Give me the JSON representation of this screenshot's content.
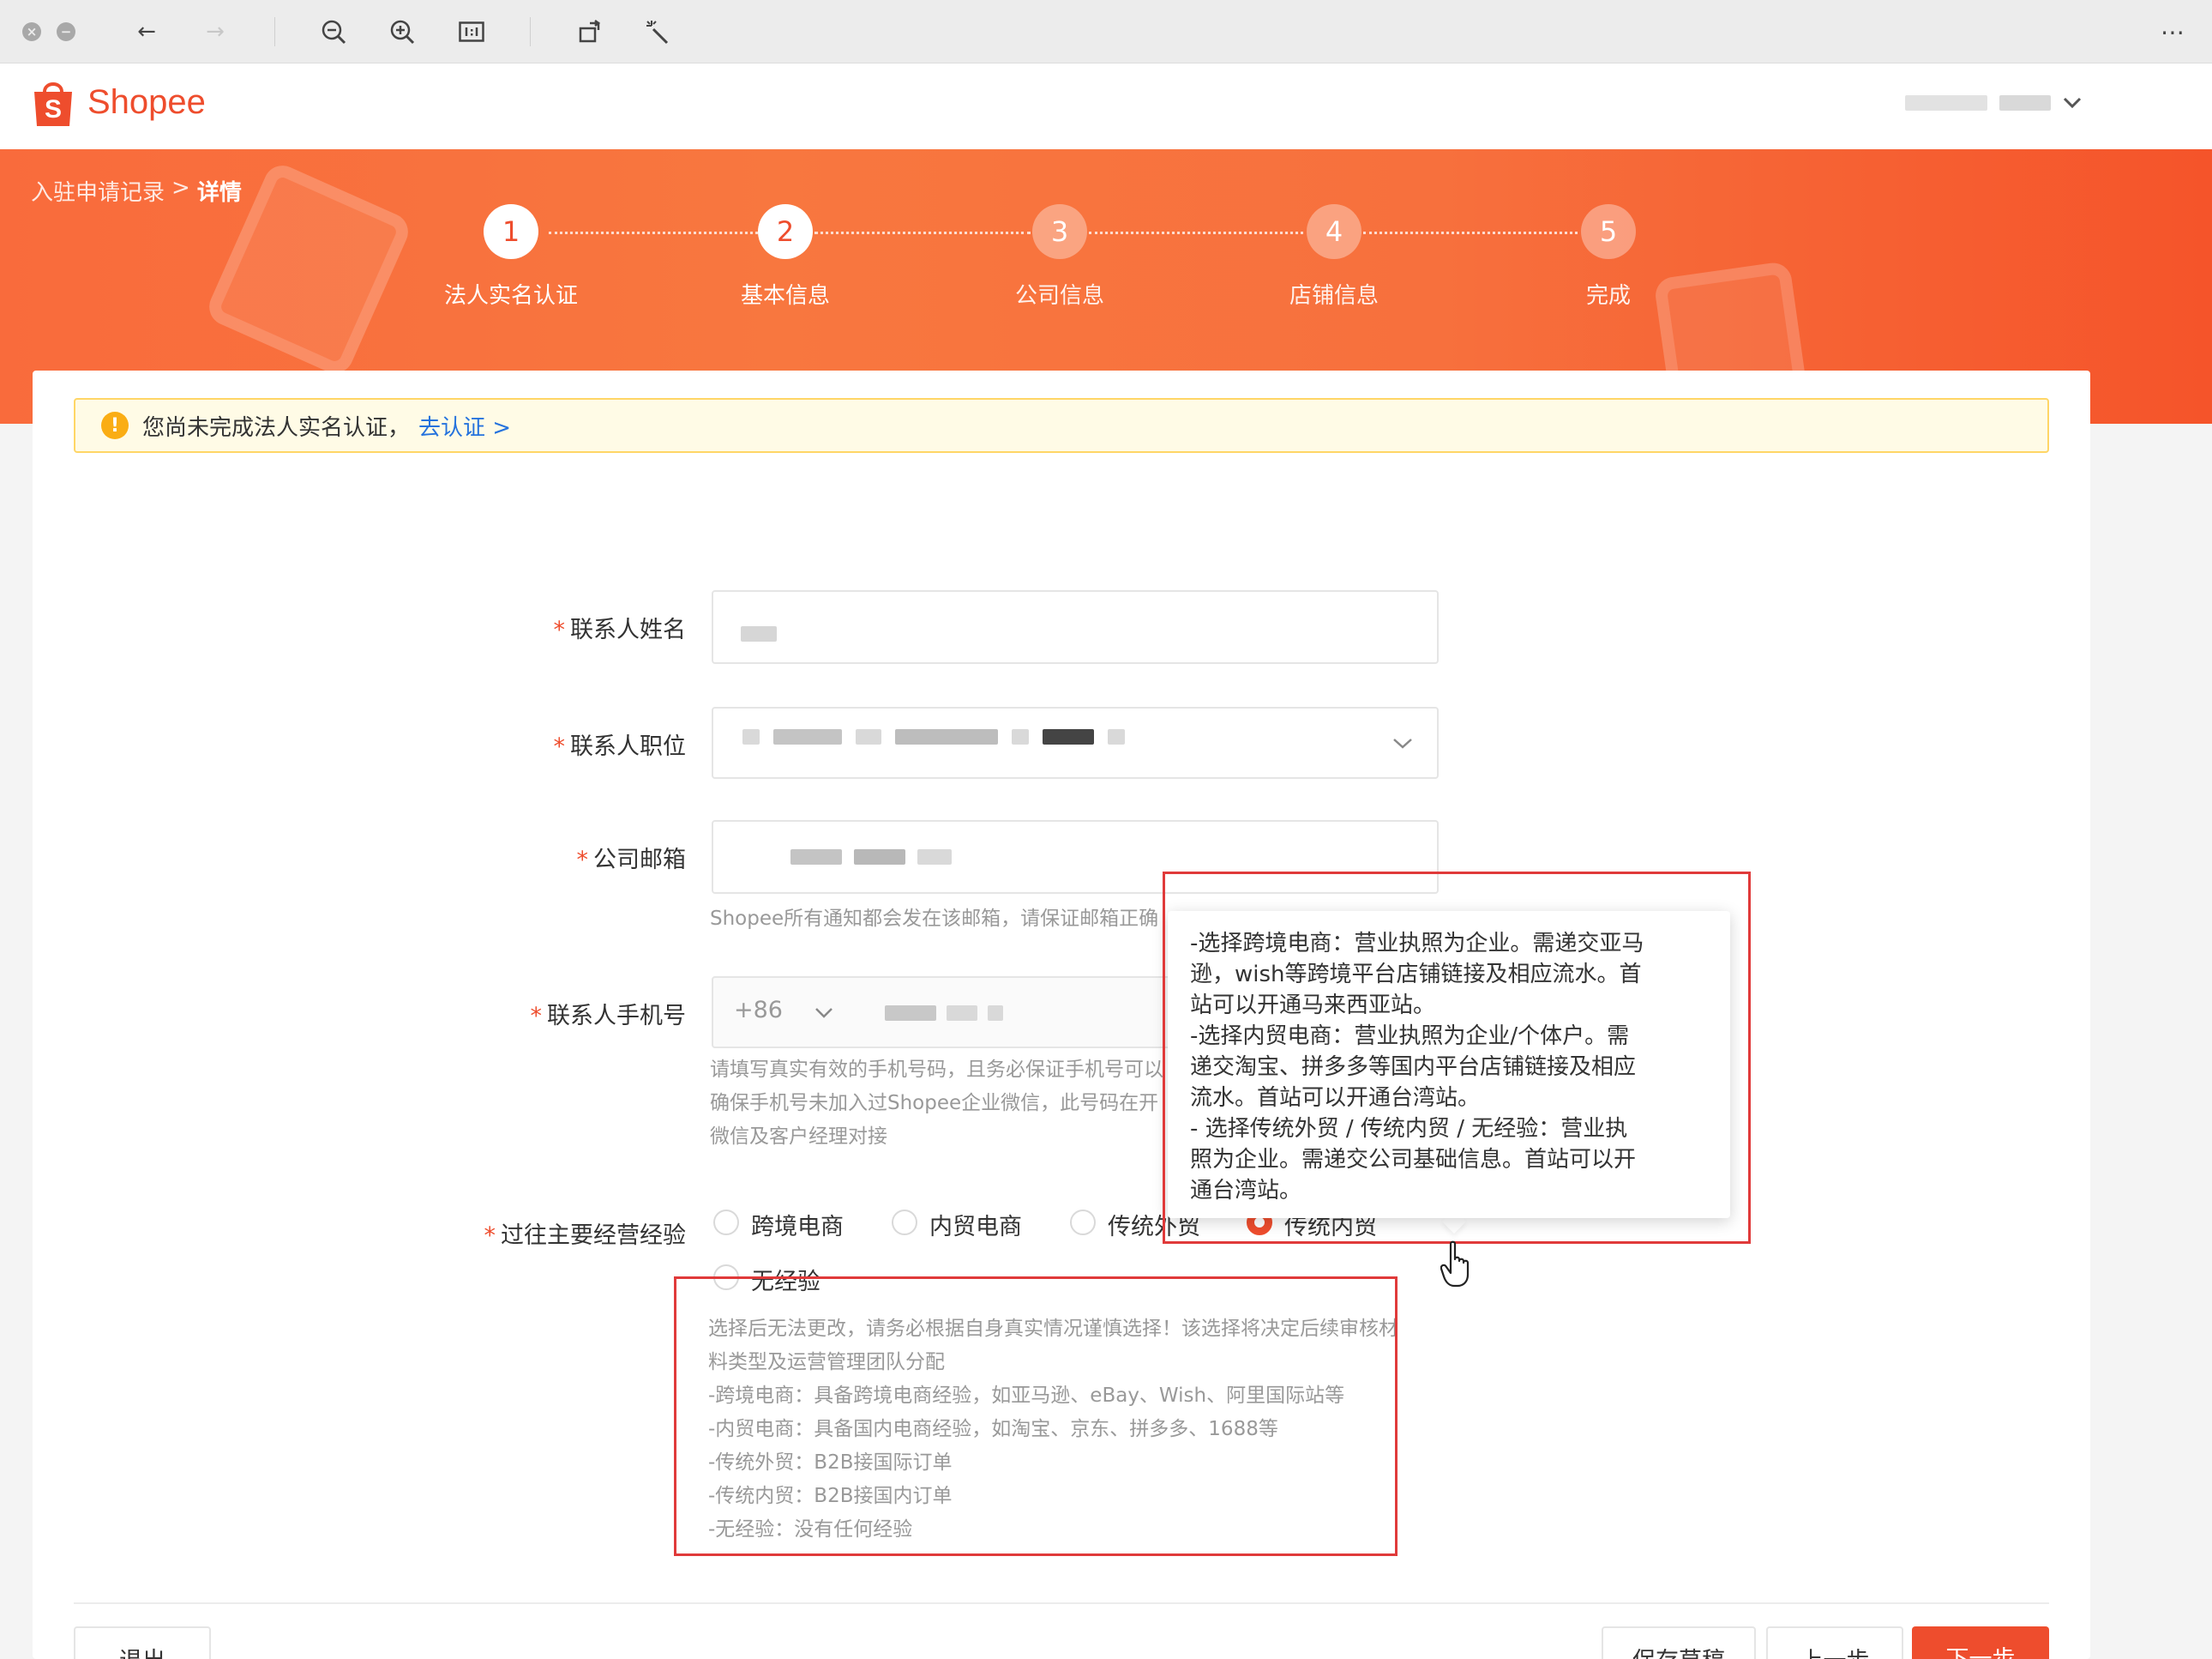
{
  "header": {
    "logo_text": "Shopee"
  },
  "breadcrumb": {
    "parent": "入驻申请记录",
    "separator": ">",
    "current": "详情"
  },
  "steps": [
    {
      "num": "1",
      "label": "法人实名认证",
      "status": "active"
    },
    {
      "num": "2",
      "label": "基本信息",
      "status": "active"
    },
    {
      "num": "3",
      "label": "公司信息",
      "status": "todo"
    },
    {
      "num": "4",
      "label": "店铺信息",
      "status": "todo"
    },
    {
      "num": "5",
      "label": "完成",
      "status": "todo"
    }
  ],
  "notice": {
    "text": "您尚未完成法人实名认证，",
    "link": "去认证 >"
  },
  "form": {
    "required_mark": "*",
    "contact_name": {
      "label": "联系人姓名"
    },
    "contact_position": {
      "label": "联系人职位"
    },
    "company_email": {
      "label": "公司邮箱",
      "hint": "Shopee所有通知都会发在该邮箱，请保证邮箱正确"
    },
    "contact_phone": {
      "label": "联系人手机号",
      "country_code": "+86",
      "hint_lines": [
        "请填写真实有效的手机号码，且务必保证手机号可以",
        "确保手机号未加入过Shopee企业微信，此号码在开",
        "微信及客户经理对接"
      ]
    },
    "experience": {
      "label": "过往主要经营经验",
      "options": [
        "跨境电商",
        "内贸电商",
        "传统外贸",
        "传统内贸",
        "无经验"
      ],
      "selected": "传统内贸",
      "hint_lines": [
        "选择后无法更改，请务必根据自身真实情况谨慎选择！该选择将决定后续审核材",
        "料类型及运营管理团队分配",
        "-跨境电商：具备跨境电商经验，如亚马逊、eBay、Wish、阿里国际站等",
        "-内贸电商：具备国内电商经验，如淘宝、京东、拼多多、1688等",
        "-传统外贸：B2B接国际订单",
        "-传统内贸：B2B接国内订单",
        "-无经验：没有任何经验"
      ]
    }
  },
  "tooltip": {
    "lines": [
      "-选择跨境电商：营业执照为企业。需递交亚马",
      "逊，wish等跨境平台店铺链接及相应流水。首",
      "站可以开通马来西亚站。",
      "-选择内贸电商：营业执照为企业/个体户。需",
      "递交淘宝、拼多多等国内平台店铺链接及相应",
      "流水。首站可以开通台湾站。",
      "- 选择传统外贸 / 传统内贸 / 无经验：营业执",
      "照为企业。需递交公司基础信息。首站可以开",
      "通台湾站。"
    ]
  },
  "footer": {
    "exit": "退出",
    "save_draft": "保存草稿",
    "prev": "上一步",
    "next": "下一步"
  },
  "colors": {
    "brand": "#ee4d2d",
    "link": "#2673dd",
    "annotation": "#e03a3a"
  }
}
